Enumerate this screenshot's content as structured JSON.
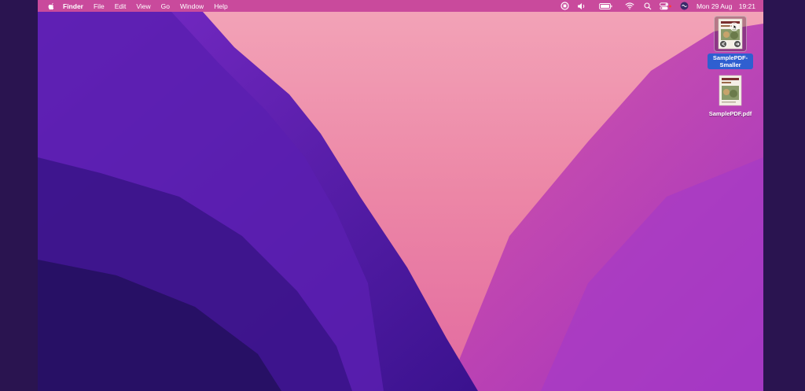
{
  "menubar": {
    "app_name": "Finder",
    "menus": [
      "File",
      "Edit",
      "View",
      "Go",
      "Window",
      "Help"
    ],
    "status_icons": [
      "screen-record-icon",
      "volume-icon",
      "battery-icon",
      "wifi-icon",
      "spotlight-search-icon",
      "control-center-icon",
      "siri-icon"
    ],
    "date": "Mon 29 Aug",
    "time": "19:21"
  },
  "desktop": {
    "icons": [
      {
        "label": "SamplePDF-Smaller",
        "selected": true
      },
      {
        "label": "SamplePDF.pdf",
        "selected": false
      }
    ]
  },
  "colors": {
    "menubar": "#c94a9c",
    "selection": "#2f5fd0",
    "wallpaper_pink": "#ee8aa8",
    "wallpaper_purple": "#5a1fb0"
  }
}
